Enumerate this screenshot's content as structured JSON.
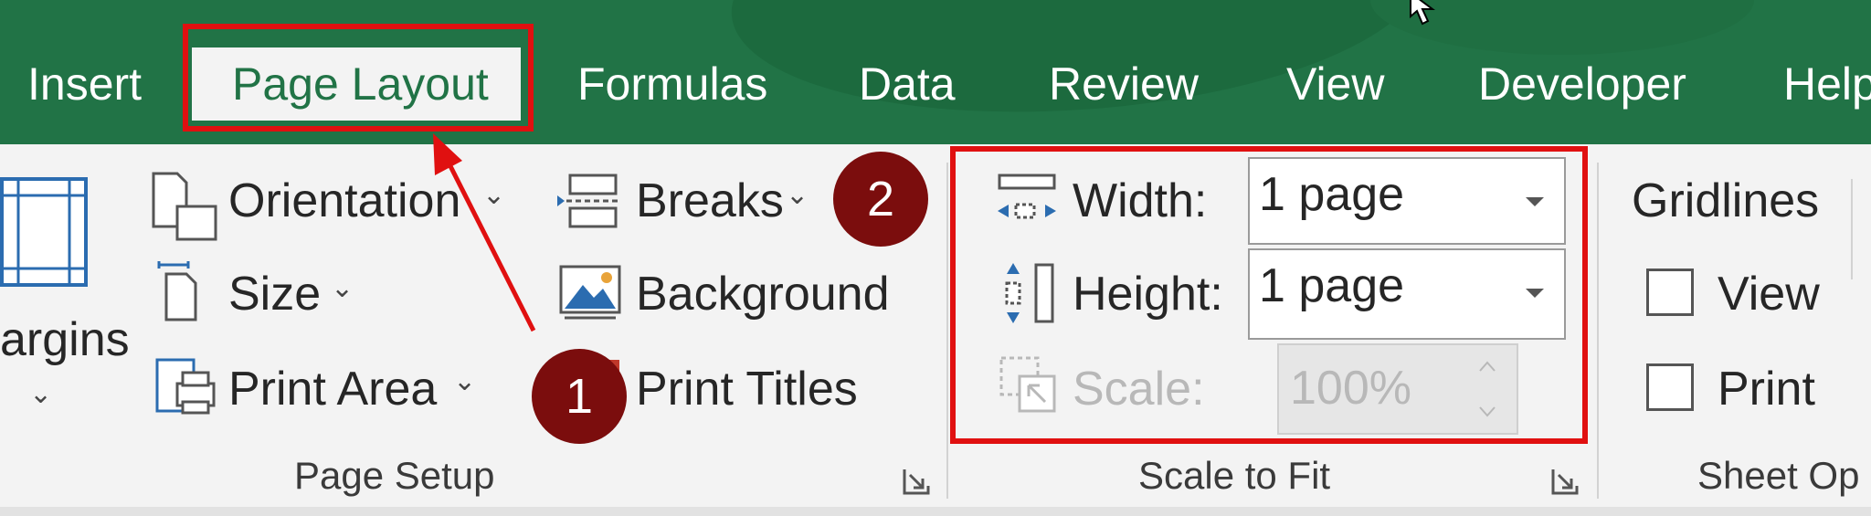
{
  "tabs": [
    "Insert",
    "Page Layout",
    "Formulas",
    "Data",
    "Review",
    "View",
    "Developer",
    "Help"
  ],
  "page_setup": {
    "margins_label": "argins",
    "orientation_label": "Orientation",
    "size_label": "Size",
    "print_area_label": "Print Area",
    "breaks_label": "Breaks",
    "background_label": "Background",
    "print_titles_label": "Print Titles",
    "group_label": "Page Setup"
  },
  "scale_to_fit": {
    "width_label": "Width:",
    "width_value": "1 page",
    "height_label": "Height:",
    "height_value": "1 page",
    "scale_label": "Scale:",
    "scale_value": "100%",
    "group_label": "Scale to Fit"
  },
  "sheet_options": {
    "gridlines_label": "Gridlines",
    "view_label": "View",
    "print_label": "Print",
    "view_checked": false,
    "print_checked": false,
    "group_label": "Sheet Op"
  },
  "annotations": {
    "badge_1": "1",
    "badge_2": "2",
    "highlight_color": "#e01010",
    "badge_color": "#7b0d0d"
  },
  "colors": {
    "tab_bar": "#217346",
    "ribbon": "#f3f3f3"
  }
}
